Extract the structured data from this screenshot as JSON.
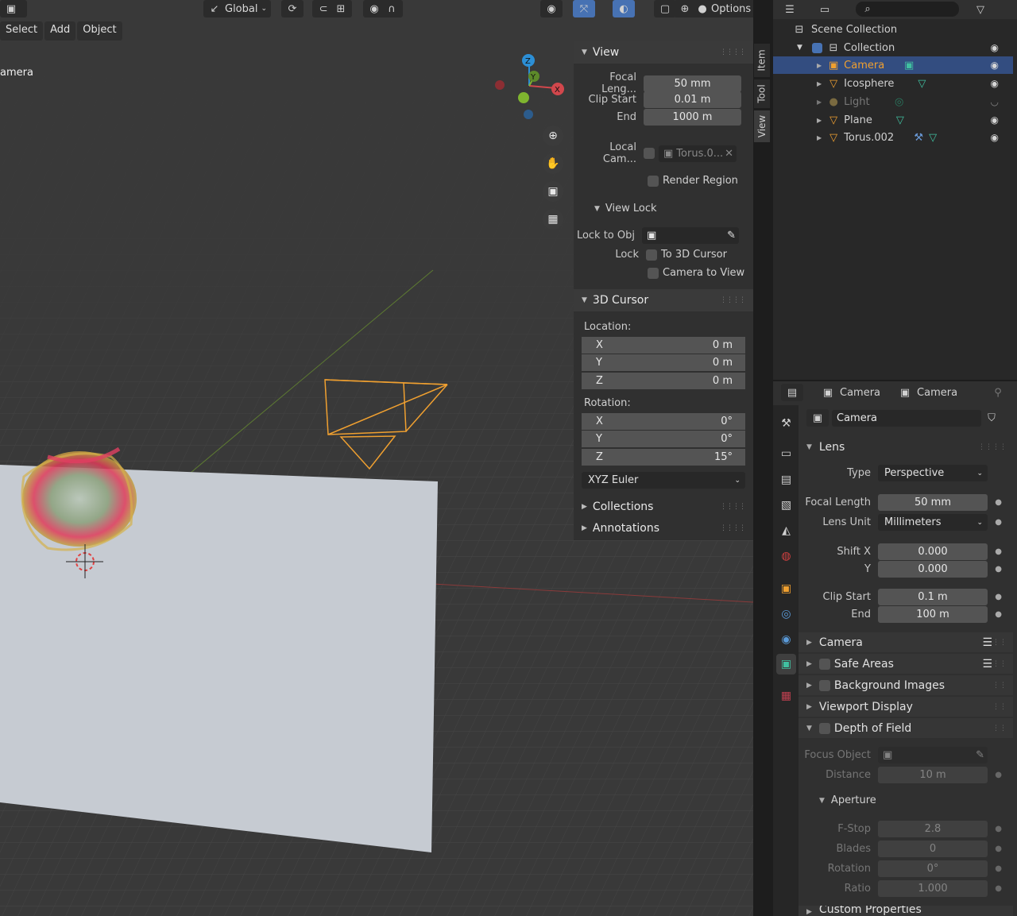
{
  "header": {
    "transform_orientation": "Global",
    "options_label": "Options"
  },
  "menubar": {
    "select": "Select",
    "add": "Add",
    "object": "Object"
  },
  "viewport": {
    "active_object_text": "amera"
  },
  "gizmo": {
    "z": "Z",
    "y": "Y",
    "x": "X"
  },
  "npanel": {
    "tabs": [
      "Item",
      "Tool",
      "View"
    ],
    "view_section": "View",
    "focal_length_label": "Focal Leng...",
    "focal_length_value": "50 mm",
    "clip_start_label": "Clip Start",
    "clip_start_value": "0.01 m",
    "clip_end_label": "End",
    "clip_end_value": "1000 m",
    "local_camera_label": "Local Cam...",
    "local_camera_value": "Torus.0...",
    "render_region_label": "Render Region",
    "view_lock_section": "View Lock",
    "lock_to_obj_label": "Lock to Obj",
    "lock_label": "Lock",
    "to_3d_cursor_label": "To 3D Cursor",
    "camera_to_view_label": "Camera to View",
    "cursor_section": "3D Cursor",
    "location_label": "Location:",
    "location": [
      {
        "axis": "X",
        "value": "0 m"
      },
      {
        "axis": "Y",
        "value": "0 m"
      },
      {
        "axis": "Z",
        "value": "0 m"
      }
    ],
    "rotation_label": "Rotation:",
    "rotation": [
      {
        "axis": "X",
        "value": "0°"
      },
      {
        "axis": "Y",
        "value": "0°"
      },
      {
        "axis": "Z",
        "value": "15°"
      }
    ],
    "rotation_mode": "XYZ Euler",
    "collections_section": "Collections",
    "annotations_section": "Annotations"
  },
  "outliner": {
    "scene_collection": "Scene Collection",
    "collection": "Collection",
    "items": [
      "Camera",
      "Icosphere",
      "Light",
      "Plane",
      "Torus.002"
    ]
  },
  "properties": {
    "breadcrumb_object": "Camera",
    "breadcrumb_data": "Camera",
    "datablock_name": "Camera",
    "lens_section": "Lens",
    "type_label": "Type",
    "type_value": "Perspective",
    "focal_length_label": "Focal Length",
    "focal_length_value": "50 mm",
    "lens_unit_label": "Lens Unit",
    "lens_unit_value": "Millimeters",
    "shift_x_label": "Shift X",
    "shift_x_value": "0.000",
    "shift_y_label": "Y",
    "shift_y_value": "0.000",
    "clip_start_label": "Clip Start",
    "clip_start_value": "0.1 m",
    "clip_end_label": "End",
    "clip_end_value": "100 m",
    "camera_section": "Camera",
    "safe_areas_section": "Safe Areas",
    "background_images_section": "Background Images",
    "viewport_display_section": "Viewport Display",
    "dof_section": "Depth of Field",
    "focus_object_label": "Focus Object",
    "distance_label": "Distance",
    "distance_value": "10 m",
    "aperture_section": "Aperture",
    "fstop_label": "F-Stop",
    "fstop_value": "2.8",
    "blades_label": "Blades",
    "blades_value": "0",
    "rotation_label": "Rotation",
    "rotation_value": "0°",
    "ratio_label": "Ratio",
    "ratio_value": "1.000",
    "custom_properties_section": "Custom Properties"
  },
  "colors": {
    "accent": "#4772b3",
    "selected_row": "#334d80",
    "camera_orange": "#f0a030",
    "axis_red": "#d2474c",
    "axis_green": "#7fb52f",
    "axis_blue": "#2c8fd6"
  }
}
